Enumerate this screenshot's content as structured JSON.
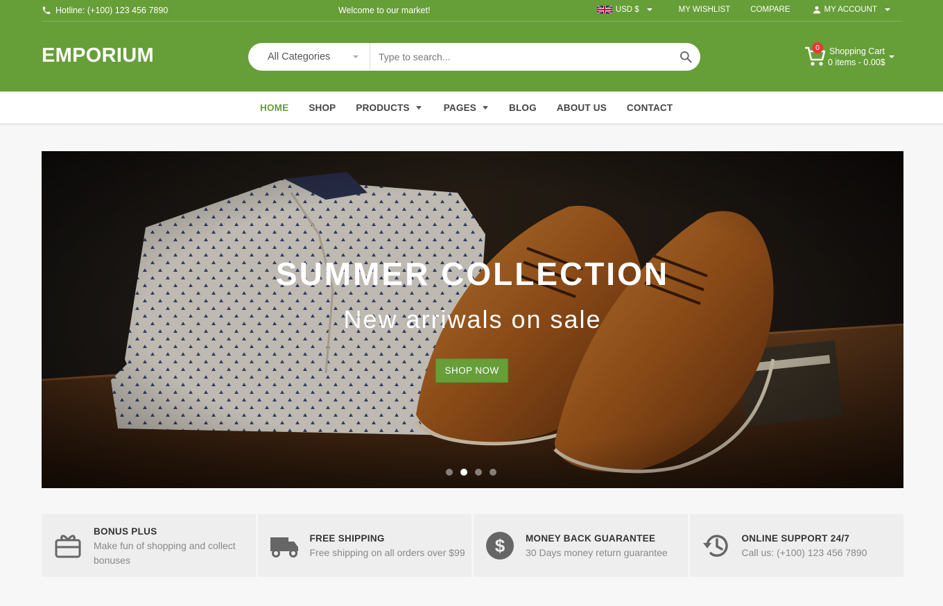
{
  "topbar": {
    "hotline": "Hotline: (+100) 123 456 7890",
    "welcome": "Welcome to our market!",
    "currency": "USD $",
    "wishlist": "MY WISHLIST",
    "compare": "COMPARE",
    "account": "MY ACCOUNT"
  },
  "header": {
    "logo": "EMPORIUM",
    "search": {
      "category": "All Categories",
      "placeholder": "Type to search..."
    },
    "cart": {
      "count": "0",
      "title": "Shopping Cart",
      "summary": "0 items - 0.00$"
    }
  },
  "nav": {
    "items": [
      {
        "label": "HOME"
      },
      {
        "label": "SHOP"
      },
      {
        "label": "PRODUCTS"
      },
      {
        "label": "PAGES"
      },
      {
        "label": "BLOG"
      },
      {
        "label": "ABOUT US"
      },
      {
        "label": "CONTACT"
      }
    ]
  },
  "hero": {
    "headline": "SUMMER COLLECTION",
    "subline": "New arriwals on sale",
    "button": "SHOP NOW",
    "slides": 4,
    "active_slide": 2
  },
  "features": [
    {
      "icon": "gift-icon",
      "title": "BONUS PLUS",
      "desc": "Make fun of shopping and collect bonuses"
    },
    {
      "icon": "truck-icon",
      "title": "FREE SHIPPING",
      "desc": "Free shipping on all orders over $99"
    },
    {
      "icon": "dollar-icon",
      "title": "MONEY BACK GUARANTEE",
      "desc": "30 Days money return guarantee"
    },
    {
      "icon": "history-icon",
      "title": "ONLINE SUPPORT 24/7",
      "desc": "Call us: (+100) 123 456 7890"
    }
  ],
  "colors": {
    "brand": "#669e38",
    "badge": "#e53935"
  }
}
